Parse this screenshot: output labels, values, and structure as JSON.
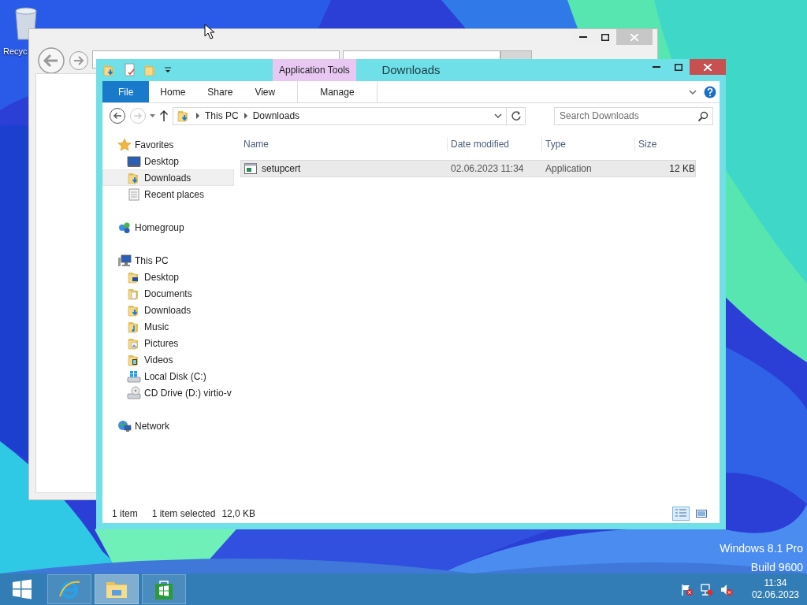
{
  "desktop": {
    "icons": [
      {
        "label": "Recyc"
      }
    ],
    "version_lines": [
      "Windows 8.1 Pro",
      "Build 9600"
    ]
  },
  "explorer": {
    "title": "Downloads",
    "contextual_header": "Application Tools",
    "ribbon_tabs": [
      {
        "label": "File",
        "kind": "file"
      },
      {
        "label": "Home",
        "kind": "plain"
      },
      {
        "label": "Share",
        "kind": "plain"
      },
      {
        "label": "View",
        "kind": "plain"
      },
      {
        "label": "Manage",
        "kind": "contextual"
      }
    ],
    "breadcrumb": [
      "This PC",
      "Downloads"
    ],
    "search": {
      "placeholder": "Search Downloads"
    },
    "nav": [
      {
        "label": "Favorites",
        "kind": "star",
        "selected": false,
        "children": [
          {
            "label": "Desktop",
            "kind": "desktop",
            "selected": false
          },
          {
            "label": "Downloads",
            "kind": "downloads",
            "selected": true
          },
          {
            "label": "Recent places",
            "kind": "recent",
            "selected": false
          }
        ]
      },
      {
        "label": "Homegroup",
        "kind": "homegroup",
        "selected": false
      },
      {
        "label": "This PC",
        "kind": "pc",
        "selected": false,
        "children": [
          {
            "label": "Desktop",
            "kind": "desktopfolder",
            "selected": false
          },
          {
            "label": "Documents",
            "kind": "documents",
            "selected": false
          },
          {
            "label": "Downloads",
            "kind": "downloads",
            "selected": false
          },
          {
            "label": "Music",
            "kind": "music",
            "selected": false
          },
          {
            "label": "Pictures",
            "kind": "pictures",
            "selected": false
          },
          {
            "label": "Videos",
            "kind": "videos",
            "selected": false
          },
          {
            "label": "Local Disk (C:)",
            "kind": "disk",
            "selected": false
          },
          {
            "label": "CD Drive (D:) virtio-v",
            "kind": "cd",
            "selected": false
          }
        ]
      },
      {
        "label": "Network",
        "kind": "network",
        "selected": false
      }
    ],
    "table": {
      "columns": [
        "Name",
        "Date modified",
        "Type",
        "Size"
      ],
      "rows": [
        {
          "cells": [
            "setupcert",
            "02.06.2023 11:34",
            "Application",
            "12 KB"
          ],
          "selected": true
        }
      ]
    },
    "status": [
      "1 item",
      "1 item selected",
      "12,0 KB"
    ]
  },
  "taskbar": {
    "apps": [
      {
        "kind": "ie",
        "selected": false
      },
      {
        "kind": "explorer",
        "selected": true
      },
      {
        "kind": "store",
        "selected": false
      }
    ],
    "clock": {
      "time": "11:34",
      "date": "02.06.2023"
    }
  }
}
